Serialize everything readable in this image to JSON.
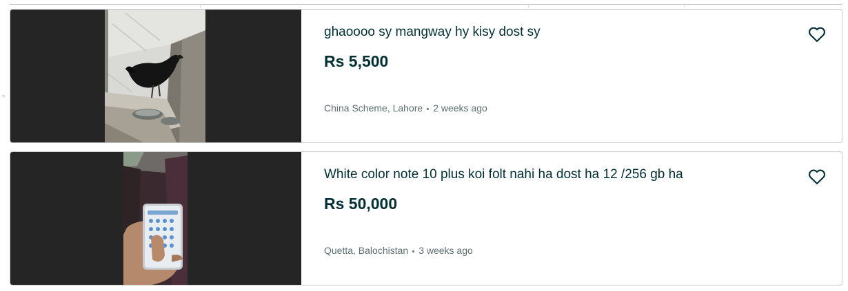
{
  "listings": [
    {
      "title": "ghaoooo sy mangway hy kisy dost sy",
      "price": "Rs 5,500",
      "location": "China Scheme, Lahore",
      "time": "2 weeks ago",
      "image_icon": "rooster-photo",
      "favorite_icon": "heart-icon"
    },
    {
      "title": "White color note 10 plus koi folt nahi ha dost ha 12 /256 gb ha",
      "price": "Rs 50,000",
      "location": "Quetta, Balochistan",
      "time": "3 weeks ago",
      "image_icon": "phone-in-hand-photo",
      "favorite_icon": "heart-icon"
    }
  ],
  "colors": {
    "text_primary": "#002f34",
    "text_secondary": "#5e6d70",
    "border": "#c8cbcc",
    "thumb_background": "#252525"
  }
}
